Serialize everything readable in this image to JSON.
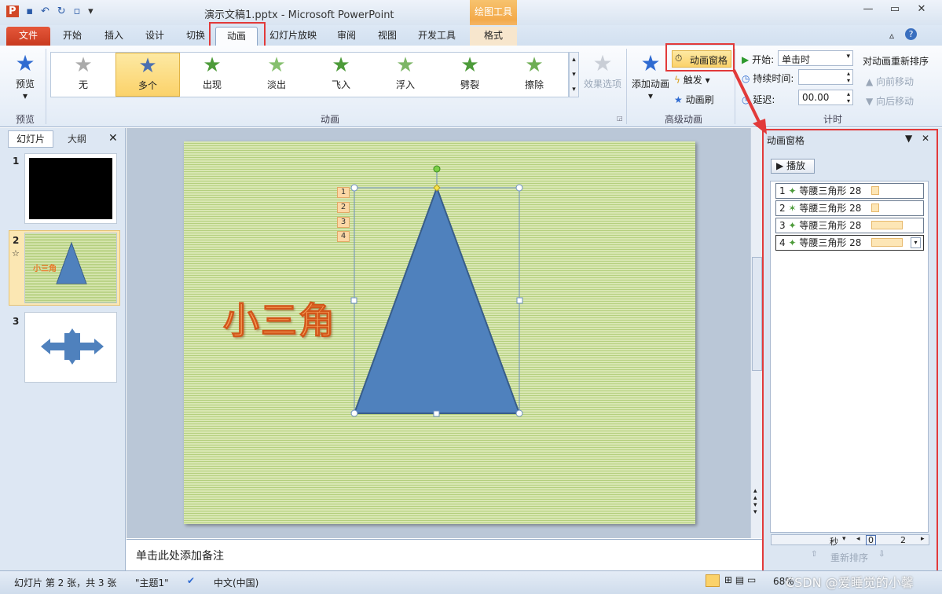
{
  "window": {
    "title": "演示文稿1.pptx - Microsoft PowerPoint",
    "context_tab": "绘图工具"
  },
  "tabs": [
    "文件",
    "开始",
    "插入",
    "设计",
    "切换",
    "动画",
    "幻灯片放映",
    "审阅",
    "视图",
    "开发工具",
    "格式"
  ],
  "ribbon": {
    "preview": {
      "label": "预览",
      "group": "预览"
    },
    "gallery": [
      "无",
      "多个",
      "出现",
      "淡出",
      "飞入",
      "浮入",
      "劈裂",
      "擦除"
    ],
    "effect_options": "效果选项",
    "animation_group": "动画",
    "add_animation": "添加动画",
    "anim_pane_btn": "动画窗格",
    "trigger": "触发",
    "anim_painter": "动画刷",
    "advanced_group": "高级动画",
    "start_label": "开始:",
    "start_value": "单击时",
    "duration_label": "持续时间:",
    "delay_label": "延迟:",
    "delay_value": "00.00",
    "reorder_title": "对动画重新排序",
    "move_earlier": "向前移动",
    "move_later": "向后移动",
    "timing_group": "计时"
  },
  "panel_tabs": {
    "slides": "幻灯片",
    "outline": "大纲"
  },
  "slides": [
    {
      "num": "1"
    },
    {
      "num": "2",
      "title": "小三角"
    },
    {
      "num": "3"
    }
  ],
  "slide": {
    "wordart": "小三角",
    "tags": [
      "1",
      "2",
      "3",
      "4"
    ]
  },
  "notes": "单击此处添加备注",
  "anim_pane": {
    "title": "动画窗格",
    "play": "播放",
    "items": [
      {
        "n": "1",
        "label": "等腰三角形 28",
        "bar": 0.05
      },
      {
        "n": "2",
        "label": "等腰三角形 28",
        "bar": 0.05
      },
      {
        "n": "3",
        "label": "等腰三角形 28",
        "bar": 0.2
      },
      {
        "n": "4",
        "label": "等腰三角形 28",
        "bar": 0.2
      }
    ],
    "unit": "秒",
    "ruler_0": "0",
    "ruler_2": "2",
    "reorder": "重新排序"
  },
  "status": {
    "slide_info": "幻灯片 第 2 张，共 3 张",
    "theme": "\"主题1\"",
    "lang": "中文(中国)",
    "zoom": "68%"
  },
  "watermark": "CSDN @爱睡觉的小馨",
  "colors": {
    "accent": "#e23a3a",
    "triangle": "#4f81bd"
  }
}
